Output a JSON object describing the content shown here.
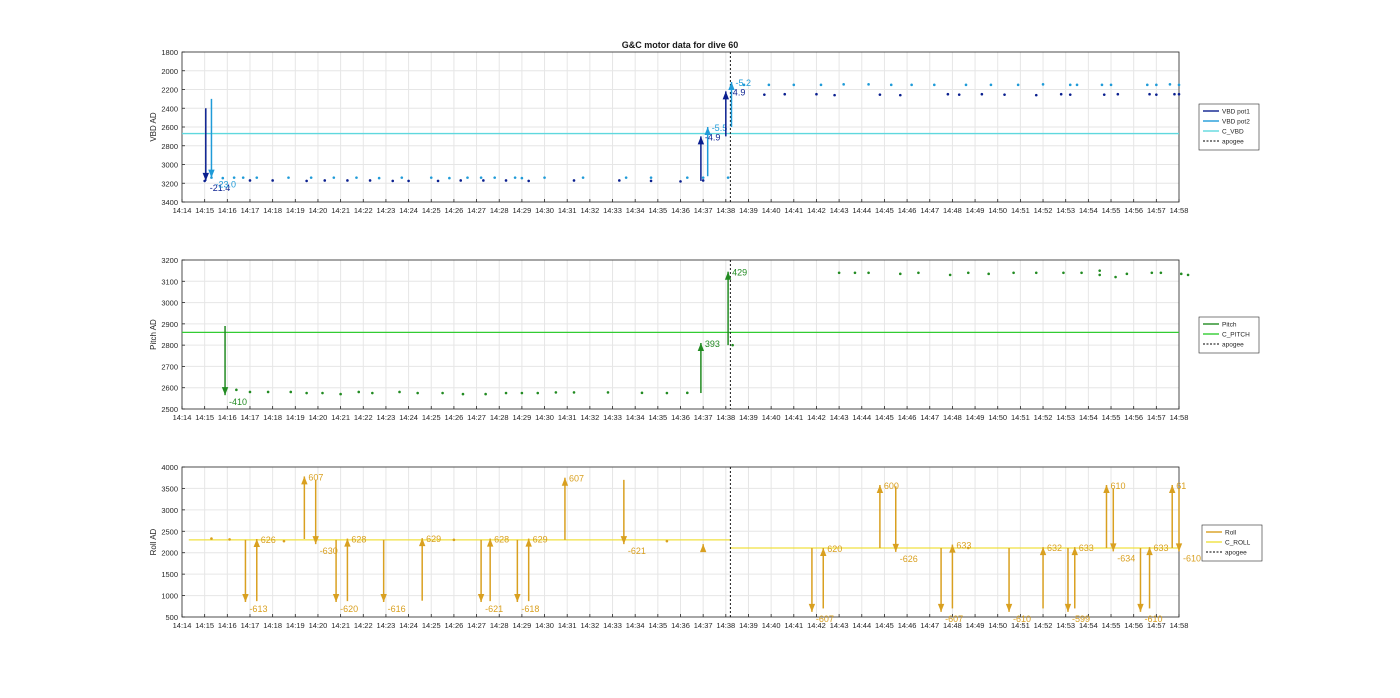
{
  "figure": {
    "title": "G&C motor data for dive 60",
    "x_ticks": [
      "14:14",
      "14:15",
      "14:16",
      "14:17",
      "14:18",
      "14:19",
      "14:20",
      "14:21",
      "14:22",
      "14:23",
      "14:24",
      "14:25",
      "14:26",
      "14:27",
      "14:28",
      "14:29",
      "14:30",
      "14:31",
      "14:32",
      "14:33",
      "14:34",
      "14:35",
      "14:36",
      "14:37",
      "14:38",
      "14:39",
      "14:40",
      "14:41",
      "14:42",
      "14:43",
      "14:44",
      "14:45",
      "14:46",
      "14:47",
      "14:48",
      "14:49",
      "14:50",
      "14:51",
      "14:52",
      "14:53",
      "14:54",
      "14:55",
      "14:56",
      "14:57",
      "14:58"
    ],
    "x_range": [
      "14:14",
      "14:58"
    ],
    "apogee_time": "14:38.2",
    "colors": {
      "vbd_pot1": "#0a1f8f",
      "vbd_pot2": "#1f9bd8",
      "c_vbd": "#5fd8de",
      "pitch": "#228b22",
      "c_pitch": "#33cc33",
      "roll": "#d9a020",
      "c_roll": "#f0e040",
      "apogee": "#000000",
      "grid": "#e6e6e6"
    }
  },
  "chart_data": [
    {
      "type": "line",
      "ylabel": "VBD AD",
      "ylim": [
        3400,
        1800
      ],
      "y_reversed": true,
      "y_ticks": [
        "1800",
        "2000",
        "2200",
        "2400",
        "2600",
        "2800",
        "3000",
        "3200",
        "3400"
      ],
      "grid": true,
      "legend_position": "right",
      "legend": [
        "VBD pot1",
        "VBD pot2",
        "C_VBD",
        "apogee"
      ],
      "reference_lines": [
        {
          "name": "C_VBD",
          "value": 2670,
          "color_key": "c_vbd"
        }
      ],
      "series": [
        {
          "name": "VBD pot1",
          "color_key": "vbd_pot1",
          "times": [
            15.0,
            17.0,
            18.0,
            19.5,
            20.3,
            21.3,
            22.3,
            23.3,
            24.0,
            25.3,
            26.3,
            27.3,
            28.3,
            29.3,
            31.3,
            33.3,
            34.7,
            36.0,
            37.0,
            38.0,
            39.7,
            40.6,
            42.0,
            42.8,
            44.8,
            45.7,
            47.8,
            48.3,
            49.3,
            50.3,
            51.7,
            52.8,
            53.2,
            54.7,
            55.3,
            56.7,
            57.0,
            57.8,
            58.0
          ],
          "values": [
            3175,
            3170,
            3170,
            3175,
            3170,
            3170,
            3170,
            3175,
            3175,
            3175,
            3170,
            3170,
            3170,
            3175,
            3170,
            3170,
            3175,
            3180,
            3170,
            2260,
            2255,
            2250,
            2250,
            2260,
            2255,
            2260,
            2250,
            2255,
            2250,
            2255,
            2260,
            2250,
            2255,
            2255,
            2250,
            2250,
            2255,
            2250,
            2250
          ]
        },
        {
          "name": "VBD pot2",
          "color_key": "vbd_pot2",
          "times": [
            15.3,
            15.8,
            16.3,
            16.7,
            17.3,
            18.7,
            19.7,
            20.7,
            21.7,
            22.7,
            23.7,
            25.0,
            25.8,
            26.6,
            27.2,
            27.8,
            28.7,
            29.0,
            30.0,
            31.7,
            33.6,
            34.7,
            36.3,
            37.0,
            38.1,
            38.8,
            39.9,
            41.0,
            42.2,
            43.2,
            44.3,
            45.3,
            46.2,
            47.2,
            48.6,
            49.7,
            50.9,
            52.0,
            53.2,
            53.5,
            54.6,
            55.0,
            56.6,
            57.0,
            57.6,
            58.0
          ],
          "values": [
            3140,
            3145,
            3140,
            3140,
            3140,
            3140,
            3140,
            3140,
            3140,
            3145,
            3140,
            3140,
            3145,
            3140,
            3140,
            3140,
            3140,
            3145,
            3140,
            3140,
            3140,
            3140,
            3140,
            3140,
            3140,
            2150,
            2150,
            2150,
            2150,
            2145,
            2145,
            2150,
            2150,
            2150,
            2150,
            2150,
            2150,
            2145,
            2150,
            2150,
            2150,
            2150,
            2150,
            2150,
            2145,
            2150
          ]
        }
      ],
      "annotations": [
        {
          "label": "-21.4",
          "time": 15.05,
          "from": 2400,
          "to": 3175,
          "color_key": "vbd_pot1"
        },
        {
          "label": "-23.0",
          "time": 15.3,
          "from": 2300,
          "to": 3140,
          "color_key": "vbd_pot2"
        },
        {
          "label": "-4.9",
          "time": 36.9,
          "from": 3175,
          "to": 2700,
          "color_key": "vbd_pot1"
        },
        {
          "label": "-5.5",
          "time": 37.2,
          "from": 3125,
          "to": 2600,
          "color_key": "vbd_pot2"
        },
        {
          "label": "-4.9",
          "time": 38.0,
          "from": 2700,
          "to": 2220,
          "color_key": "vbd_pot1"
        },
        {
          "label": "-5.2",
          "time": 38.25,
          "from": 2600,
          "to": 2120,
          "color_key": "vbd_pot2"
        }
      ]
    },
    {
      "type": "line",
      "ylabel": "Pitch AD",
      "ylim": [
        2500,
        3200
      ],
      "y_ticks": [
        "2500",
        "2600",
        "2700",
        "2800",
        "2900",
        "3000",
        "3100",
        "3200"
      ],
      "grid": true,
      "legend_position": "right",
      "legend": [
        "Pitch",
        "C_PITCH",
        "apogee"
      ],
      "reference_lines": [
        {
          "name": "C_PITCH",
          "value": 2860,
          "color_key": "c_pitch"
        }
      ],
      "series": [
        {
          "name": "Pitch",
          "color_key": "pitch",
          "times": [
            16.4,
            17.0,
            17.8,
            18.8,
            19.5,
            20.2,
            21.0,
            21.8,
            22.4,
            23.6,
            24.4,
            25.5,
            26.4,
            27.4,
            28.3,
            29.0,
            29.7,
            30.5,
            31.3,
            32.8,
            34.3,
            35.4,
            36.3,
            38.3,
            43.0,
            43.7,
            44.3,
            45.7,
            46.5,
            47.9,
            48.7,
            49.6,
            50.7,
            51.7,
            52.9,
            53.7,
            54.5,
            54.5,
            55.2,
            55.7,
            56.8,
            57.2,
            58.1,
            58.4
          ],
          "values": [
            2590,
            2580,
            2580,
            2580,
            2575,
            2575,
            2570,
            2580,
            2575,
            2580,
            2575,
            2575,
            2570,
            2570,
            2575,
            2575,
            2575,
            2578,
            2578,
            2578,
            2576,
            2575,
            2576,
            2800,
            3140,
            3140,
            3140,
            3135,
            3140,
            3130,
            3140,
            3135,
            3140,
            3140,
            3140,
            3140,
            3150,
            3130,
            3120,
            3135,
            3140,
            3140,
            3135,
            3130
          ]
        }
      ],
      "annotations": [
        {
          "label": "-410",
          "time": 15.9,
          "from": 2890,
          "to": 2565,
          "color_key": "pitch"
        },
        {
          "label": "393",
          "time": 36.9,
          "from": 2575,
          "to": 2810,
          "color_key": "pitch"
        },
        {
          "label": "429",
          "time": 38.1,
          "from": 2800,
          "to": 3145,
          "color_key": "pitch"
        }
      ]
    },
    {
      "type": "line",
      "ylabel": "Roll AD",
      "ylim": [
        500,
        4000
      ],
      "y_ticks": [
        "500",
        "1000",
        "1500",
        "2000",
        "2500",
        "3000",
        "3500",
        "4000"
      ],
      "grid": true,
      "legend_position": "right",
      "legend": [
        "Roll",
        "C_ROLL",
        "apogee"
      ],
      "reference_lines": [
        {
          "name": "C_ROLL",
          "value": 2300,
          "time_range": [
            14.3,
            38.2
          ],
          "color_key": "c_roll"
        },
        {
          "name": "C_ROLL",
          "value": 2110,
          "time_range": [
            38.2,
            58.0
          ],
          "color_key": "c_roll"
        }
      ],
      "series": [
        {
          "name": "Roll",
          "color_key": "roll",
          "times": [
            15.3,
            16.1,
            18.5,
            26.0,
            35.4,
            48.7
          ],
          "values": [
            2330,
            2310,
            2270,
            2300,
            2270,
            2110
          ]
        }
      ],
      "annotations": [
        {
          "label": "-613",
          "time": 16.8,
          "from": 2300,
          "to": 850,
          "color_key": "roll"
        },
        {
          "label": "626",
          "time": 17.3,
          "from": 870,
          "to": 2320,
          "color_key": "roll"
        },
        {
          "label": "607",
          "time": 19.4,
          "from": 2320,
          "to": 3780,
          "color_key": "roll"
        },
        {
          "label": "-630",
          "time": 19.9,
          "from": 3700,
          "to": 2200,
          "color_key": "roll"
        },
        {
          "label": "-620",
          "time": 20.8,
          "from": 2300,
          "to": 850,
          "color_key": "roll"
        },
        {
          "label": "628",
          "time": 21.3,
          "from": 870,
          "to": 2330,
          "color_key": "roll"
        },
        {
          "label": "-616",
          "time": 22.9,
          "from": 2300,
          "to": 850,
          "color_key": "roll"
        },
        {
          "label": "629",
          "time": 24.6,
          "from": 880,
          "to": 2340,
          "color_key": "roll"
        },
        {
          "label": "-621",
          "time": 27.2,
          "from": 2300,
          "to": 850,
          "color_key": "roll"
        },
        {
          "label": "628",
          "time": 27.6,
          "from": 870,
          "to": 2330,
          "color_key": "roll"
        },
        {
          "label": "-618",
          "time": 28.8,
          "from": 2300,
          "to": 850,
          "color_key": "roll"
        },
        {
          "label": "629",
          "time": 29.3,
          "from": 870,
          "to": 2330,
          "color_key": "roll"
        },
        {
          "label": "607",
          "time": 30.9,
          "from": 2300,
          "to": 3750,
          "color_key": "roll"
        },
        {
          "label": "-621",
          "time": 33.5,
          "from": 3700,
          "to": 2200,
          "color_key": "roll"
        },
        {
          "label": "",
          "time": 37.0,
          "from": 2100,
          "to": 2200,
          "color_key": "roll"
        },
        {
          "label": "-607",
          "time": 41.8,
          "from": 2110,
          "to": 620,
          "color_key": "roll"
        },
        {
          "label": "620",
          "time": 42.3,
          "from": 700,
          "to": 2110,
          "color_key": "roll"
        },
        {
          "label": "600",
          "time": 44.8,
          "from": 2110,
          "to": 3580,
          "color_key": "roll"
        },
        {
          "label": "-626",
          "time": 45.5,
          "from": 3550,
          "to": 2020,
          "color_key": "roll"
        },
        {
          "label": "-607",
          "time": 47.5,
          "from": 2110,
          "to": 620,
          "color_key": "roll"
        },
        {
          "label": "633",
          "time": 48.0,
          "from": 700,
          "to": 2190,
          "color_key": "roll"
        },
        {
          "label": "-610",
          "time": 50.5,
          "from": 2110,
          "to": 620,
          "color_key": "roll"
        },
        {
          "label": "632",
          "time": 52.0,
          "from": 700,
          "to": 2130,
          "color_key": "roll"
        },
        {
          "label": "-599",
          "time": 53.1,
          "from": 2110,
          "to": 620,
          "color_key": "roll"
        },
        {
          "label": "633",
          "time": 53.4,
          "from": 700,
          "to": 2130,
          "color_key": "roll"
        },
        {
          "label": "610",
          "time": 54.8,
          "from": 2110,
          "to": 3580,
          "color_key": "roll"
        },
        {
          "label": "-634",
          "time": 55.1,
          "from": 3500,
          "to": 2030,
          "color_key": "roll"
        },
        {
          "label": "-610",
          "time": 56.3,
          "from": 2110,
          "to": 620,
          "color_key": "roll"
        },
        {
          "label": "633",
          "time": 56.7,
          "from": 700,
          "to": 2130,
          "color_key": "roll"
        },
        {
          "label": "61",
          "time": 57.7,
          "from": 2110,
          "to": 3580,
          "color_key": "roll"
        },
        {
          "label": "-610",
          "time": 58.0,
          "from": 3500,
          "to": 2030,
          "color_key": "roll"
        }
      ]
    }
  ]
}
